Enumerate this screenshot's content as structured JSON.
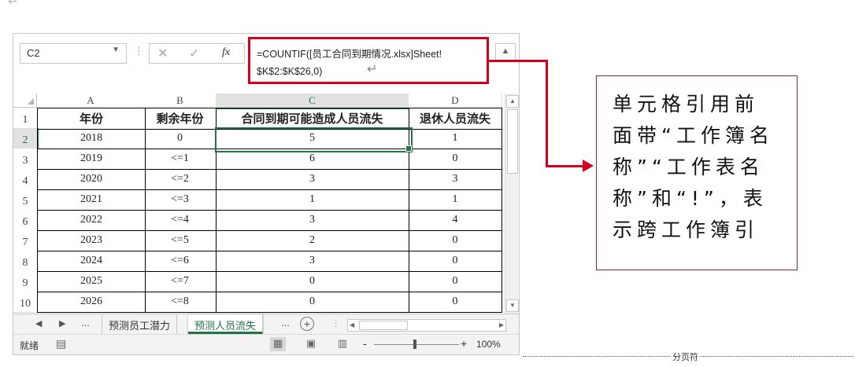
{
  "formula_bar": {
    "name_box": "C2",
    "formula_line1": "=COUNTIF([员工合同到期情况.xlsx]Sheet!",
    "formula_line2": "$K$2:$K$26,0)",
    "fx_label": "fx"
  },
  "grid": {
    "columns": [
      "A",
      "B",
      "C",
      "D"
    ],
    "selected_column": "C",
    "selected_row": "2",
    "row_numbers": [
      "1",
      "2",
      "3",
      "4",
      "5",
      "6",
      "7",
      "8",
      "9",
      "10"
    ],
    "header_row": [
      "年份",
      "剩余年份",
      "合同到期可能造成人员流失",
      "退休人员流失"
    ],
    "rows": [
      [
        "2018",
        "0",
        "5",
        "1"
      ],
      [
        "2019",
        "<=1",
        "6",
        "0"
      ],
      [
        "2020",
        "<=2",
        "3",
        "3"
      ],
      [
        "2021",
        "<=3",
        "1",
        "1"
      ],
      [
        "2022",
        "<=4",
        "3",
        "4"
      ],
      [
        "2023",
        "<=5",
        "2",
        "0"
      ],
      [
        "2024",
        "<=6",
        "3",
        "0"
      ],
      [
        "2025",
        "<=7",
        "0",
        "0"
      ],
      [
        "2026",
        "<=8",
        "0",
        "0"
      ]
    ]
  },
  "sheet_tabs": {
    "ellipsis_left": "...",
    "tabs": [
      "预测员工潜力",
      "预测人员流失"
    ],
    "active_tab": "预测人员流失",
    "ellipsis_right": "..."
  },
  "status_bar": {
    "status": "就绪",
    "zoom_minus": "-",
    "zoom_plus": "+",
    "zoom_level": "100%"
  },
  "annotation": {
    "lines": [
      "单元格引用前",
      "面带“工作簿名",
      "称”“工作表名",
      "称”和“!”，表",
      "示跨工作簿引"
    ],
    "arrow_color": "#d1001f"
  },
  "page_break_label": "分页符",
  "colors": {
    "excel_green": "#217346",
    "highlight_red": "#d1001f"
  }
}
